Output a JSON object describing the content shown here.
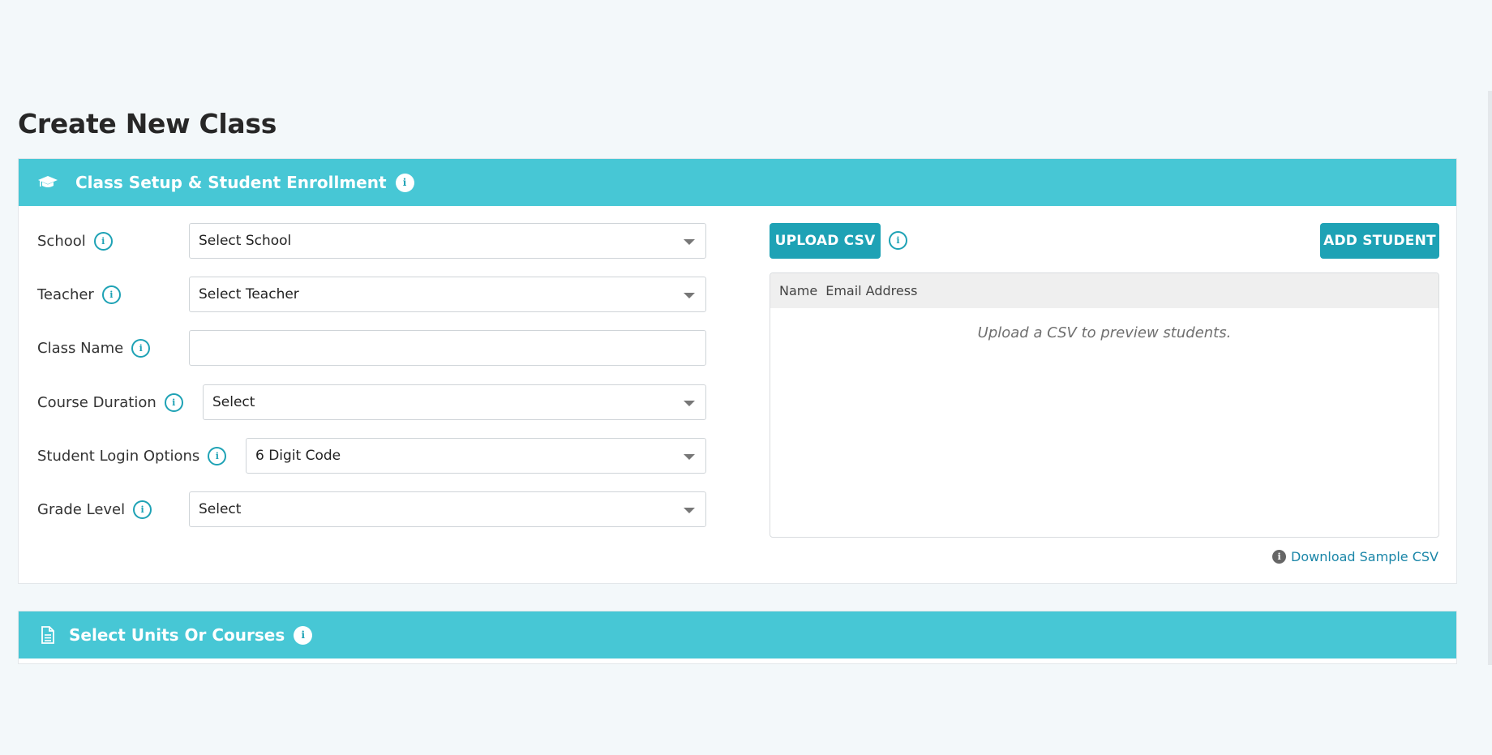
{
  "page": {
    "title": "Create New Class"
  },
  "setup_panel": {
    "title": "Class Setup & Student Enrollment",
    "fields": {
      "school": {
        "label": "School",
        "value": "Select School"
      },
      "teacher": {
        "label": "Teacher",
        "value": "Select Teacher"
      },
      "class_name": {
        "label": "Class Name",
        "value": ""
      },
      "course_duration": {
        "label": "Course Duration",
        "value": "Select"
      },
      "login_options": {
        "label": "Student Login Options",
        "value": "6 Digit Code"
      },
      "grade_level": {
        "label": "Grade Level",
        "value": "Select"
      }
    },
    "upload_csv_label": "UPLOAD CSV",
    "add_student_label": "ADD STUDENT",
    "table": {
      "columns": [
        "Name",
        "Email Address"
      ],
      "empty_message": "Upload a CSV to preview students."
    },
    "download_sample_label": "Download Sample CSV"
  },
  "units_panel": {
    "title": "Select Units Or Courses"
  },
  "icons": {
    "setup_header": "graduation-cap-icon",
    "units_header": "document-icon",
    "info": "info-icon",
    "dropdown": "chevron-down-icon"
  },
  "colors": {
    "header_bg": "#47c7d5",
    "button_bg": "#1ea2b5",
    "link": "#1a86a8",
    "page_bg": "#f3f8fa"
  }
}
